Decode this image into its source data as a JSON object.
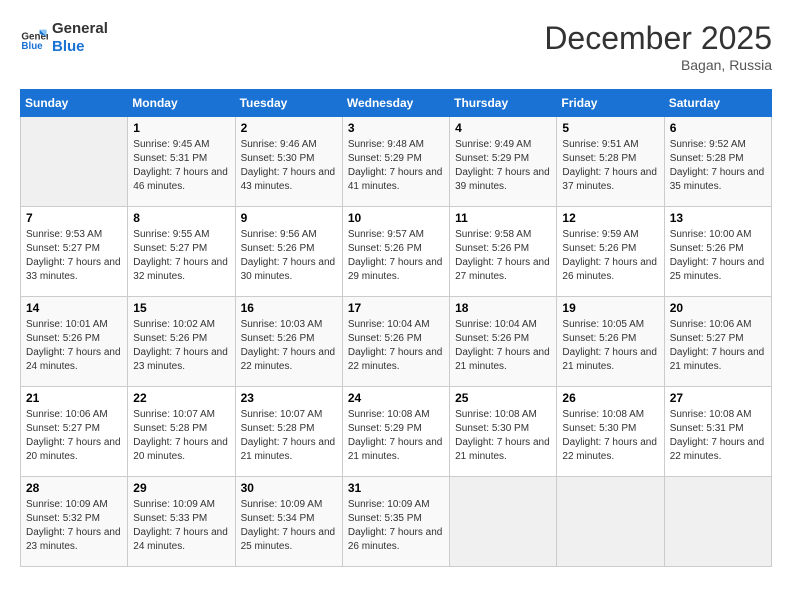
{
  "logo": {
    "line1": "General",
    "line2": "Blue"
  },
  "title": {
    "month_year": "December 2025",
    "location": "Bagan, Russia"
  },
  "days_of_week": [
    "Sunday",
    "Monday",
    "Tuesday",
    "Wednesday",
    "Thursday",
    "Friday",
    "Saturday"
  ],
  "weeks": [
    [
      {
        "num": "",
        "empty": true
      },
      {
        "num": "1",
        "sunrise": "Sunrise: 9:45 AM",
        "sunset": "Sunset: 5:31 PM",
        "daylight": "Daylight: 7 hours and 46 minutes."
      },
      {
        "num": "2",
        "sunrise": "Sunrise: 9:46 AM",
        "sunset": "Sunset: 5:30 PM",
        "daylight": "Daylight: 7 hours and 43 minutes."
      },
      {
        "num": "3",
        "sunrise": "Sunrise: 9:48 AM",
        "sunset": "Sunset: 5:29 PM",
        "daylight": "Daylight: 7 hours and 41 minutes."
      },
      {
        "num": "4",
        "sunrise": "Sunrise: 9:49 AM",
        "sunset": "Sunset: 5:29 PM",
        "daylight": "Daylight: 7 hours and 39 minutes."
      },
      {
        "num": "5",
        "sunrise": "Sunrise: 9:51 AM",
        "sunset": "Sunset: 5:28 PM",
        "daylight": "Daylight: 7 hours and 37 minutes."
      },
      {
        "num": "6",
        "sunrise": "Sunrise: 9:52 AM",
        "sunset": "Sunset: 5:28 PM",
        "daylight": "Daylight: 7 hours and 35 minutes."
      }
    ],
    [
      {
        "num": "7",
        "sunrise": "Sunrise: 9:53 AM",
        "sunset": "Sunset: 5:27 PM",
        "daylight": "Daylight: 7 hours and 33 minutes."
      },
      {
        "num": "8",
        "sunrise": "Sunrise: 9:55 AM",
        "sunset": "Sunset: 5:27 PM",
        "daylight": "Daylight: 7 hours and 32 minutes."
      },
      {
        "num": "9",
        "sunrise": "Sunrise: 9:56 AM",
        "sunset": "Sunset: 5:26 PM",
        "daylight": "Daylight: 7 hours and 30 minutes."
      },
      {
        "num": "10",
        "sunrise": "Sunrise: 9:57 AM",
        "sunset": "Sunset: 5:26 PM",
        "daylight": "Daylight: 7 hours and 29 minutes."
      },
      {
        "num": "11",
        "sunrise": "Sunrise: 9:58 AM",
        "sunset": "Sunset: 5:26 PM",
        "daylight": "Daylight: 7 hours and 27 minutes."
      },
      {
        "num": "12",
        "sunrise": "Sunrise: 9:59 AM",
        "sunset": "Sunset: 5:26 PM",
        "daylight": "Daylight: 7 hours and 26 minutes."
      },
      {
        "num": "13",
        "sunrise": "Sunrise: 10:00 AM",
        "sunset": "Sunset: 5:26 PM",
        "daylight": "Daylight: 7 hours and 25 minutes."
      }
    ],
    [
      {
        "num": "14",
        "sunrise": "Sunrise: 10:01 AM",
        "sunset": "Sunset: 5:26 PM",
        "daylight": "Daylight: 7 hours and 24 minutes."
      },
      {
        "num": "15",
        "sunrise": "Sunrise: 10:02 AM",
        "sunset": "Sunset: 5:26 PM",
        "daylight": "Daylight: 7 hours and 23 minutes."
      },
      {
        "num": "16",
        "sunrise": "Sunrise: 10:03 AM",
        "sunset": "Sunset: 5:26 PM",
        "daylight": "Daylight: 7 hours and 22 minutes."
      },
      {
        "num": "17",
        "sunrise": "Sunrise: 10:04 AM",
        "sunset": "Sunset: 5:26 PM",
        "daylight": "Daylight: 7 hours and 22 minutes."
      },
      {
        "num": "18",
        "sunrise": "Sunrise: 10:04 AM",
        "sunset": "Sunset: 5:26 PM",
        "daylight": "Daylight: 7 hours and 21 minutes."
      },
      {
        "num": "19",
        "sunrise": "Sunrise: 10:05 AM",
        "sunset": "Sunset: 5:26 PM",
        "daylight": "Daylight: 7 hours and 21 minutes."
      },
      {
        "num": "20",
        "sunrise": "Sunrise: 10:06 AM",
        "sunset": "Sunset: 5:27 PM",
        "daylight": "Daylight: 7 hours and 21 minutes."
      }
    ],
    [
      {
        "num": "21",
        "sunrise": "Sunrise: 10:06 AM",
        "sunset": "Sunset: 5:27 PM",
        "daylight": "Daylight: 7 hours and 20 minutes."
      },
      {
        "num": "22",
        "sunrise": "Sunrise: 10:07 AM",
        "sunset": "Sunset: 5:28 PM",
        "daylight": "Daylight: 7 hours and 20 minutes."
      },
      {
        "num": "23",
        "sunrise": "Sunrise: 10:07 AM",
        "sunset": "Sunset: 5:28 PM",
        "daylight": "Daylight: 7 hours and 21 minutes."
      },
      {
        "num": "24",
        "sunrise": "Sunrise: 10:08 AM",
        "sunset": "Sunset: 5:29 PM",
        "daylight": "Daylight: 7 hours and 21 minutes."
      },
      {
        "num": "25",
        "sunrise": "Sunrise: 10:08 AM",
        "sunset": "Sunset: 5:30 PM",
        "daylight": "Daylight: 7 hours and 21 minutes."
      },
      {
        "num": "26",
        "sunrise": "Sunrise: 10:08 AM",
        "sunset": "Sunset: 5:30 PM",
        "daylight": "Daylight: 7 hours and 22 minutes."
      },
      {
        "num": "27",
        "sunrise": "Sunrise: 10:08 AM",
        "sunset": "Sunset: 5:31 PM",
        "daylight": "Daylight: 7 hours and 22 minutes."
      }
    ],
    [
      {
        "num": "28",
        "sunrise": "Sunrise: 10:09 AM",
        "sunset": "Sunset: 5:32 PM",
        "daylight": "Daylight: 7 hours and 23 minutes."
      },
      {
        "num": "29",
        "sunrise": "Sunrise: 10:09 AM",
        "sunset": "Sunset: 5:33 PM",
        "daylight": "Daylight: 7 hours and 24 minutes."
      },
      {
        "num": "30",
        "sunrise": "Sunrise: 10:09 AM",
        "sunset": "Sunset: 5:34 PM",
        "daylight": "Daylight: 7 hours and 25 minutes."
      },
      {
        "num": "31",
        "sunrise": "Sunrise: 10:09 AM",
        "sunset": "Sunset: 5:35 PM",
        "daylight": "Daylight: 7 hours and 26 minutes."
      },
      {
        "num": "",
        "empty": true
      },
      {
        "num": "",
        "empty": true
      },
      {
        "num": "",
        "empty": true
      }
    ]
  ]
}
